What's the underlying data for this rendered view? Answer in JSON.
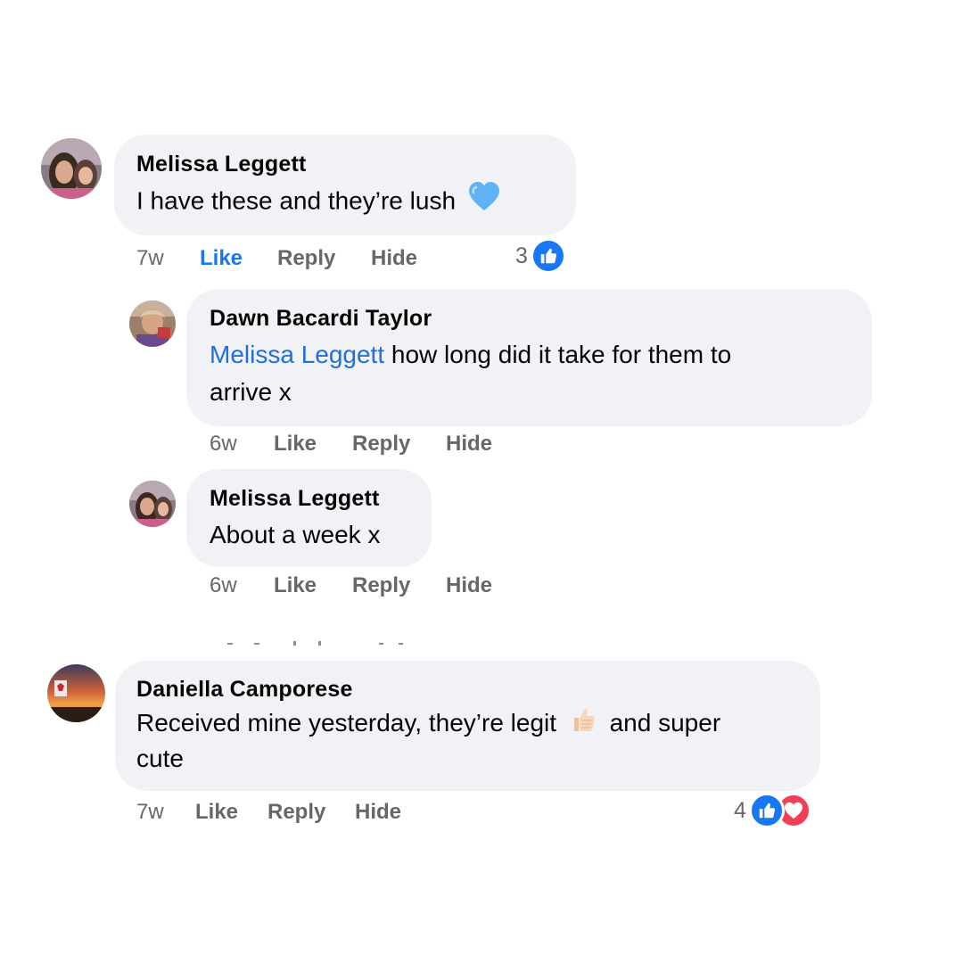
{
  "comments": [
    {
      "author": "Melissa Leggett",
      "text": "I have these and they’re lush",
      "emoji": "blue-heart",
      "time": "7w",
      "like_label": "Like",
      "reply_label": "Reply",
      "hide_label": "Hide",
      "liked_by_viewer": true,
      "reaction_count": "3",
      "reactions": [
        "like"
      ]
    },
    {
      "author": "Dawn Bacardi Taylor",
      "mention": "Melissa Leggett",
      "text_line1": "how long did it take for them to",
      "text_line2": "arrive x",
      "time": "6w",
      "like_label": "Like",
      "reply_label": "Reply",
      "hide_label": "Hide"
    },
    {
      "author": "Melissa Leggett",
      "text": "About a week x",
      "time": "6w",
      "like_label": "Like",
      "reply_label": "Reply",
      "hide_label": "Hide"
    },
    {
      "author": "Daniella Camporese",
      "text_part1": "Received mine yesterday, they’re legit",
      "emoji": "thumbs-up-light-skin",
      "text_part2": "and super",
      "text_line2": "cute",
      "time": "7w",
      "like_label": "Like",
      "reply_label": "Reply",
      "hide_label": "Hide",
      "reaction_count": "4",
      "reactions": [
        "like",
        "love"
      ]
    }
  ],
  "colors": {
    "bubble": "#f0f2f5",
    "meta": "#65676b",
    "link": "#1877f2",
    "mention": "#216fdb",
    "like_reaction": "#1877f2",
    "love_reaction": "#f33e58"
  }
}
